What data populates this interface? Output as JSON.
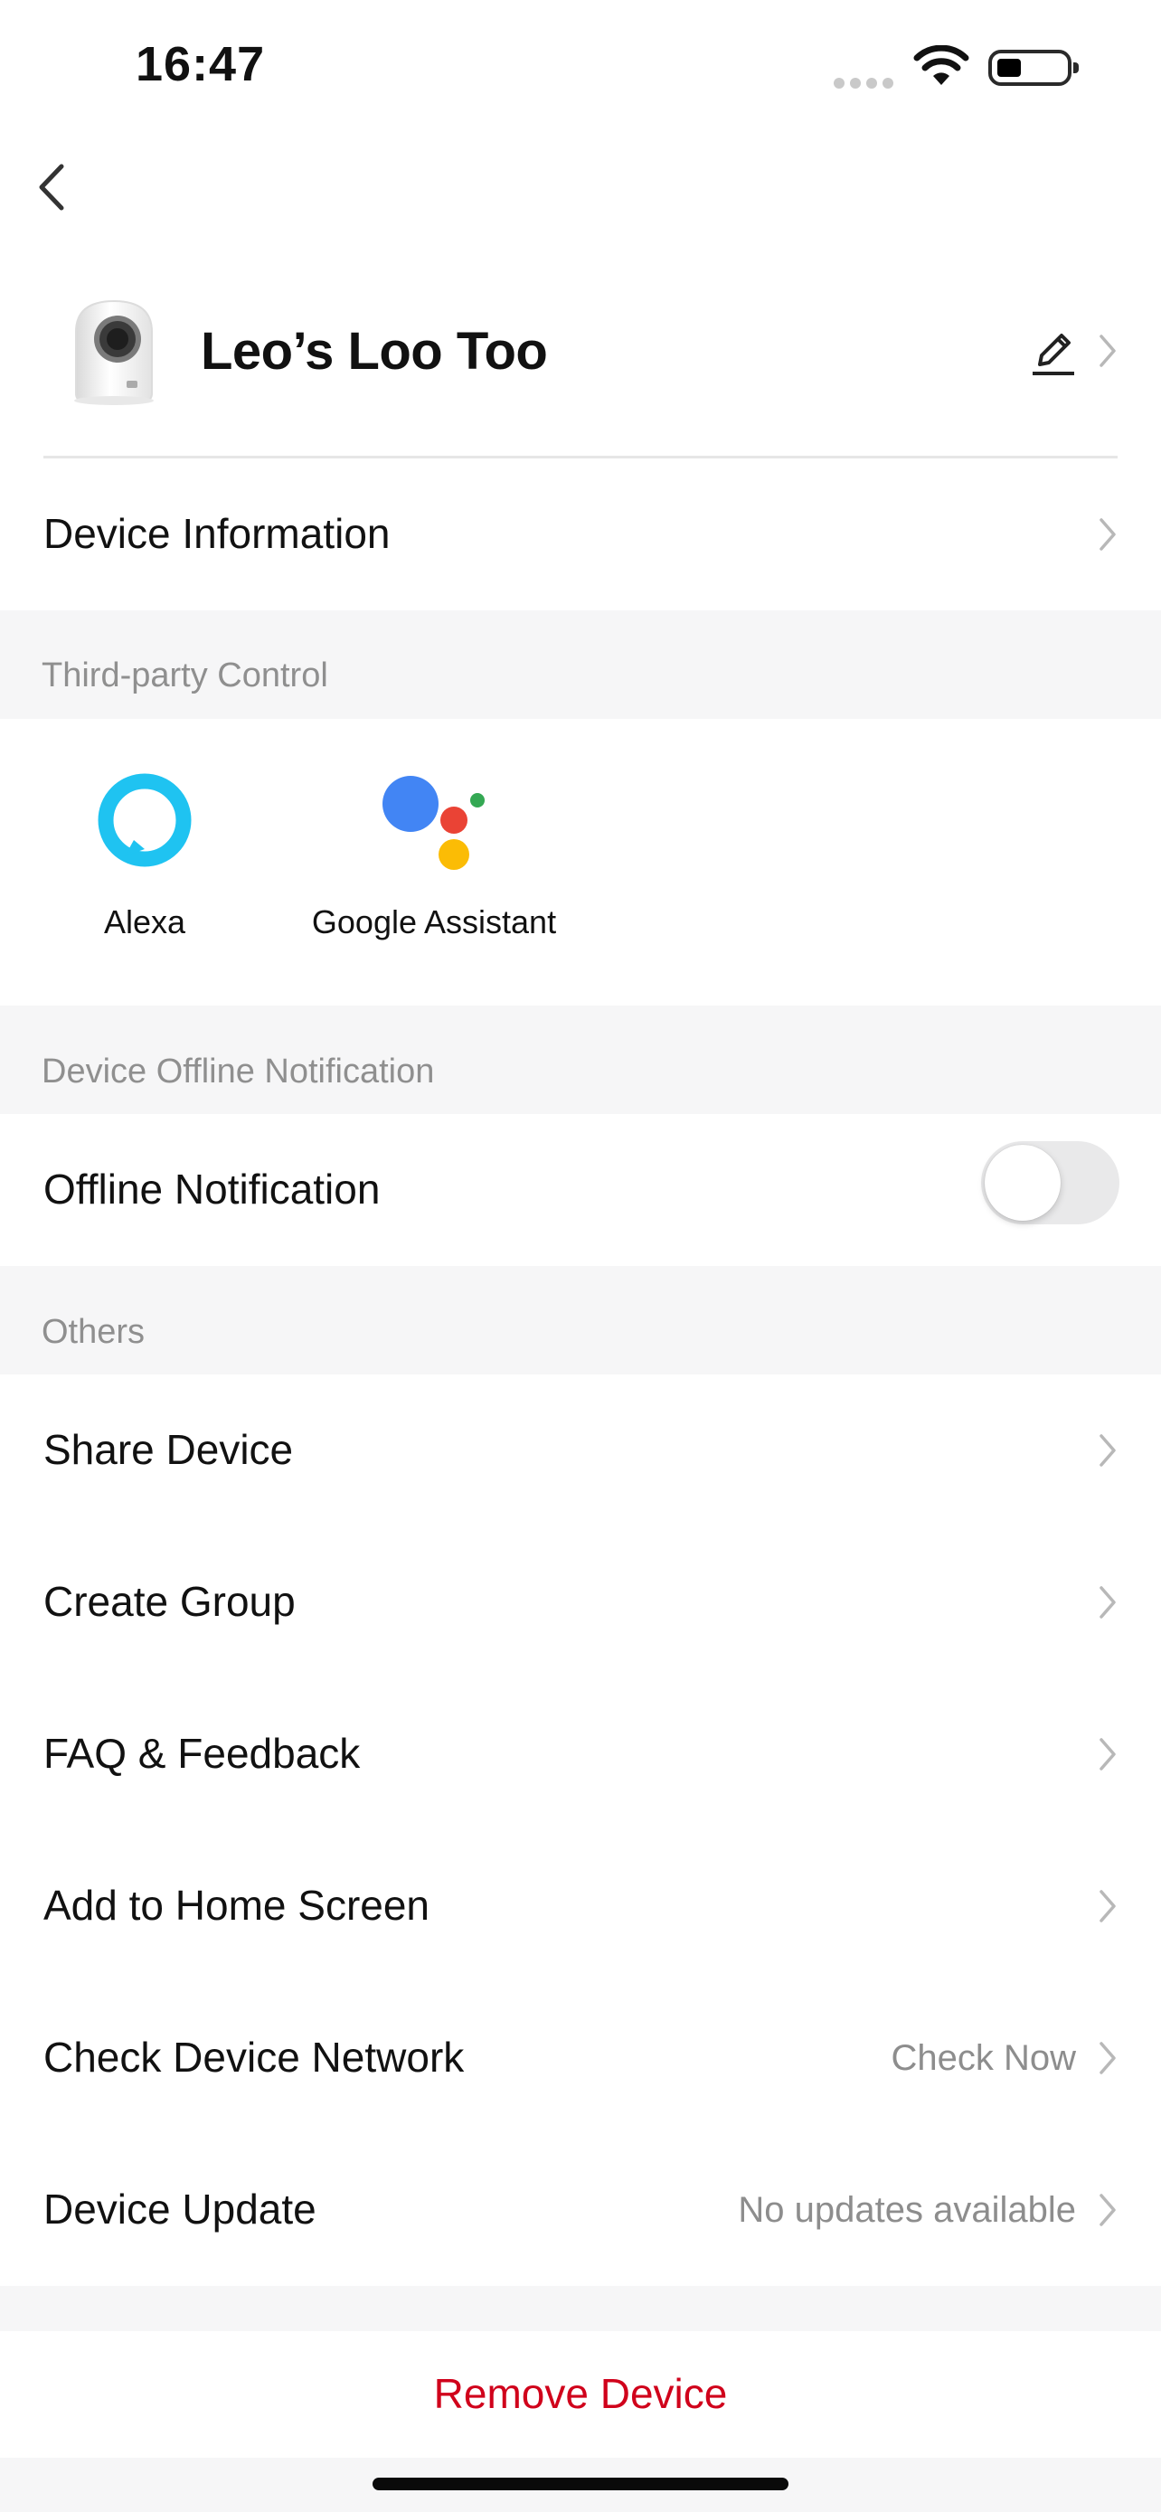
{
  "status_bar": {
    "time": "16:47"
  },
  "header": {
    "device_name": "Leo’s Loo Too"
  },
  "device_information": {
    "label": "Device Information"
  },
  "third_party": {
    "section_title": "Third-party Control",
    "items": [
      {
        "label": "Alexa",
        "icon": "alexa-icon"
      },
      {
        "label": "Google Assistant",
        "icon": "google-assistant-icon"
      }
    ]
  },
  "offline": {
    "section_title": "Device Offline Notification",
    "label": "Offline Notification",
    "enabled": false
  },
  "others": {
    "section_title": "Others",
    "items": [
      {
        "label": "Share Device",
        "value": ""
      },
      {
        "label": "Create Group",
        "value": ""
      },
      {
        "label": "FAQ & Feedback",
        "value": ""
      },
      {
        "label": "Add to Home Screen",
        "value": ""
      },
      {
        "label": "Check Device Network",
        "value": "Check Now"
      },
      {
        "label": "Device Update",
        "value": "No updates available"
      }
    ]
  },
  "remove": {
    "label": "Remove Device",
    "color": "#d0021b"
  },
  "colors": {
    "alexa": "#1fc3f1",
    "google_blue": "#4285f4",
    "google_red": "#ea4335",
    "google_yellow": "#fbbc05",
    "google_green": "#34a853"
  }
}
